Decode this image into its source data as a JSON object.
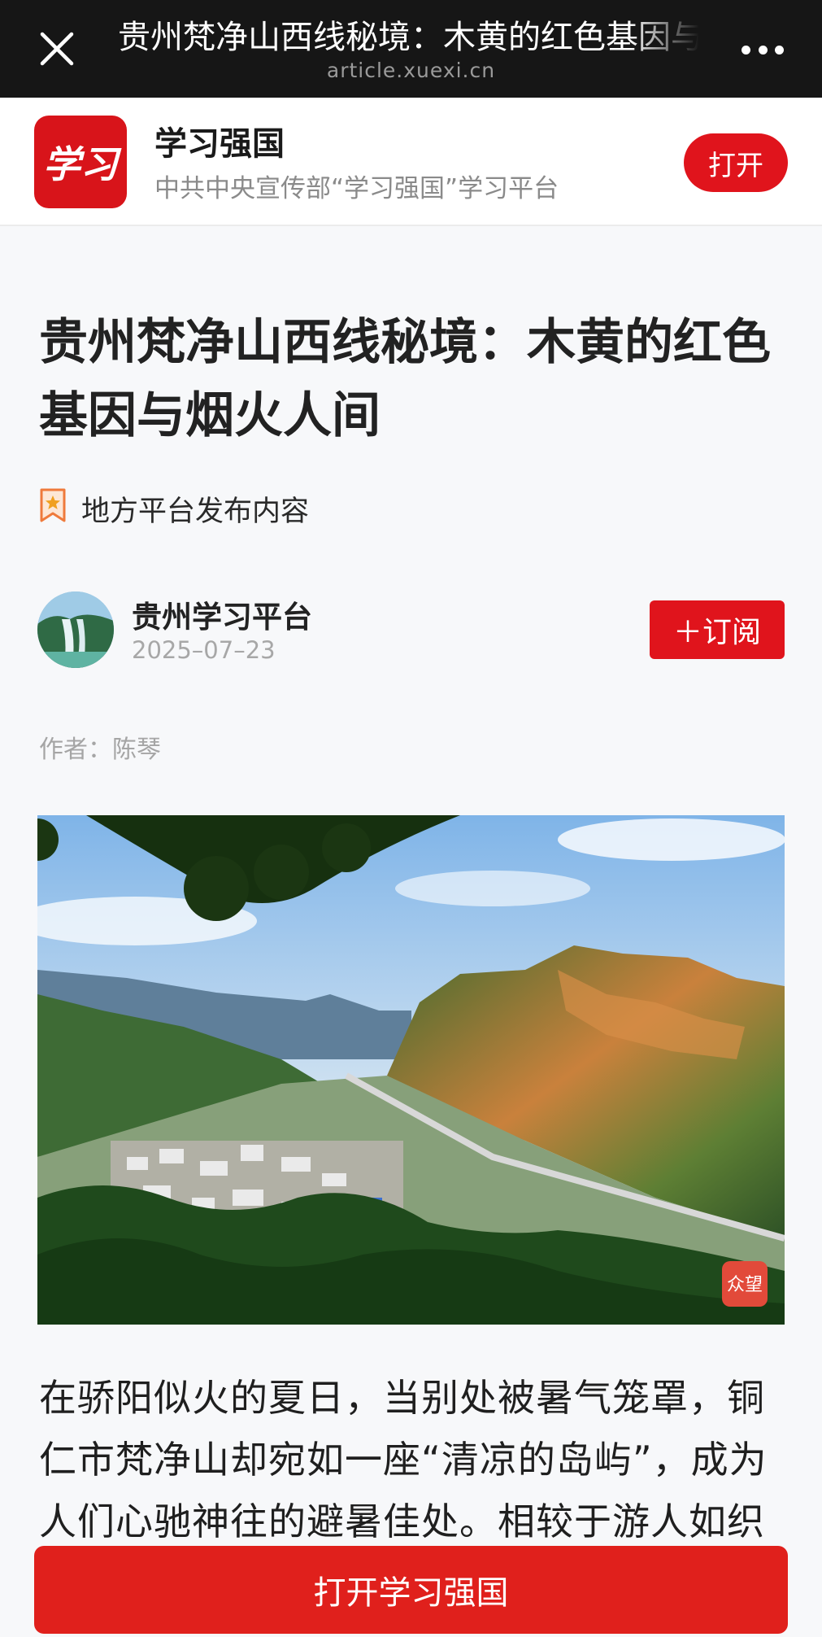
{
  "browser": {
    "title": "贵州梵净山西线秘境：木黄的红色基因与烟火人间",
    "domain": "article.xuexi.cn",
    "close_icon": "close-icon",
    "more_icon": "more-icon"
  },
  "app_banner": {
    "logo_text": "学习",
    "name": "学习强国",
    "subtitle": "中共中央宣传部“学习强国”学习平台",
    "open_label": "打开",
    "accent": "#e0141c"
  },
  "article": {
    "headline": "贵州梵净山西线秘境：木黄的红色基因与烟火人间",
    "tag": "地方平台发布内容",
    "publisher": "贵州学习平台",
    "date": "2025–07–23",
    "subscribe_label": "＋订阅",
    "author": "作者：陈琴",
    "photo_watermark": "众望",
    "body": "在骄阳似火的夏日，当别处被暑气笼罩，铜仁市梵净山却宛如一座“清凉的岛屿”，成为人们心驰神往的避暑佳处。相较于游人如织"
  },
  "footer": {
    "open_app_label": "打开学习强国"
  }
}
